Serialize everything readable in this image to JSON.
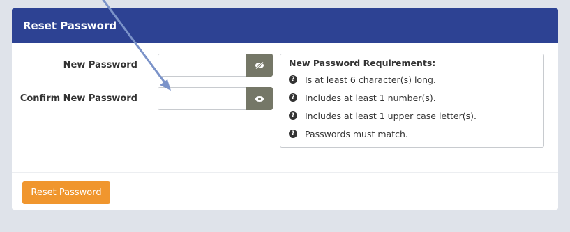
{
  "panel": {
    "title": "Reset Password"
  },
  "form": {
    "new_password_label": "New Password",
    "new_password_value": "",
    "confirm_password_label": "Confirm New Password",
    "confirm_password_value": ""
  },
  "requirements": {
    "title": "New Password Requirements:",
    "items": [
      "Is at least 6 character(s) long.",
      "Includes at least 1 number(s).",
      "Includes at least 1 upper case letter(s).",
      "Passwords must match."
    ]
  },
  "actions": {
    "reset_label": "Reset Password"
  },
  "icons": {
    "new_password_toggle": "eye-slash-icon",
    "confirm_password_toggle": "eye-icon",
    "requirement_item": "question-circle-icon"
  },
  "colors": {
    "header": "#2d4293",
    "button": "#f0962e",
    "eye_button": "#757767",
    "annotation_arrow": "#7b93c9"
  }
}
